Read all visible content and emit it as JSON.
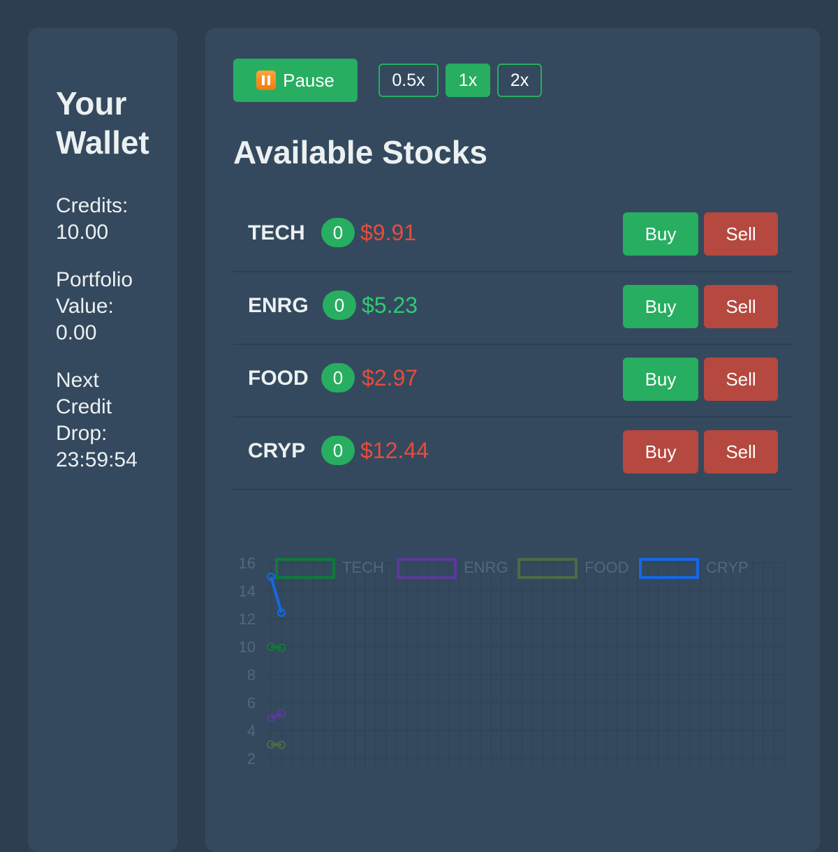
{
  "wallet": {
    "title_line1": "Your",
    "title_line2": "Wallet",
    "credits_label": "Credits:",
    "credits_value": "10.00",
    "portfolio_label_1": "Portfolio",
    "portfolio_label_2": "Value:",
    "portfolio_value": "0.00",
    "drop_label_1": "Next",
    "drop_label_2": "Credit",
    "drop_label_3": "Drop:",
    "drop_value": "23:59:54"
  },
  "controls": {
    "pause_label": "Pause",
    "pause_icon": "pause-icon",
    "speeds": [
      "0.5x",
      "1x",
      "2x"
    ],
    "active_speed": "1x"
  },
  "stocks_title": "Available Stocks",
  "stocks": [
    {
      "symbol": "TECH",
      "owned": "0",
      "price": "$9.91",
      "trend": "down",
      "buy_label": "Buy",
      "sell_label": "Sell",
      "buy_enabled": true
    },
    {
      "symbol": "ENRG",
      "owned": "0",
      "price": "$5.23",
      "trend": "up",
      "buy_label": "Buy",
      "sell_label": "Sell",
      "buy_enabled": true
    },
    {
      "symbol": "FOOD",
      "owned": "0",
      "price": "$2.97",
      "trend": "down",
      "buy_label": "Buy",
      "sell_label": "Sell",
      "buy_enabled": true
    },
    {
      "symbol": "CRYP",
      "owned": "0",
      "price": "$12.44",
      "trend": "down",
      "buy_label": "Buy",
      "sell_label": "Sell",
      "buy_enabled": false
    }
  ],
  "colors": {
    "green": "#27ae60",
    "red": "#b5483f",
    "price_down": "#e74c3c",
    "price_up": "#2ecc71"
  },
  "chart_data": {
    "type": "line",
    "x": [
      0,
      1
    ],
    "series": [
      {
        "name": "TECH",
        "color": "#0f7a3a",
        "values": [
          10.0,
          9.91
        ]
      },
      {
        "name": "ENRG",
        "color": "#5a3a9a",
        "values": [
          4.9,
          5.23
        ]
      },
      {
        "name": "FOOD",
        "color": "#4d6a45",
        "values": [
          3.0,
          2.97
        ]
      },
      {
        "name": "CRYP",
        "color": "#1469e8",
        "values": [
          15.0,
          12.44
        ]
      }
    ],
    "yticks": [
      "16",
      "14",
      "12",
      "10",
      "8",
      "6",
      "4",
      "2"
    ],
    "ylim": [
      2,
      16
    ],
    "grid": true,
    "legend": "top"
  }
}
